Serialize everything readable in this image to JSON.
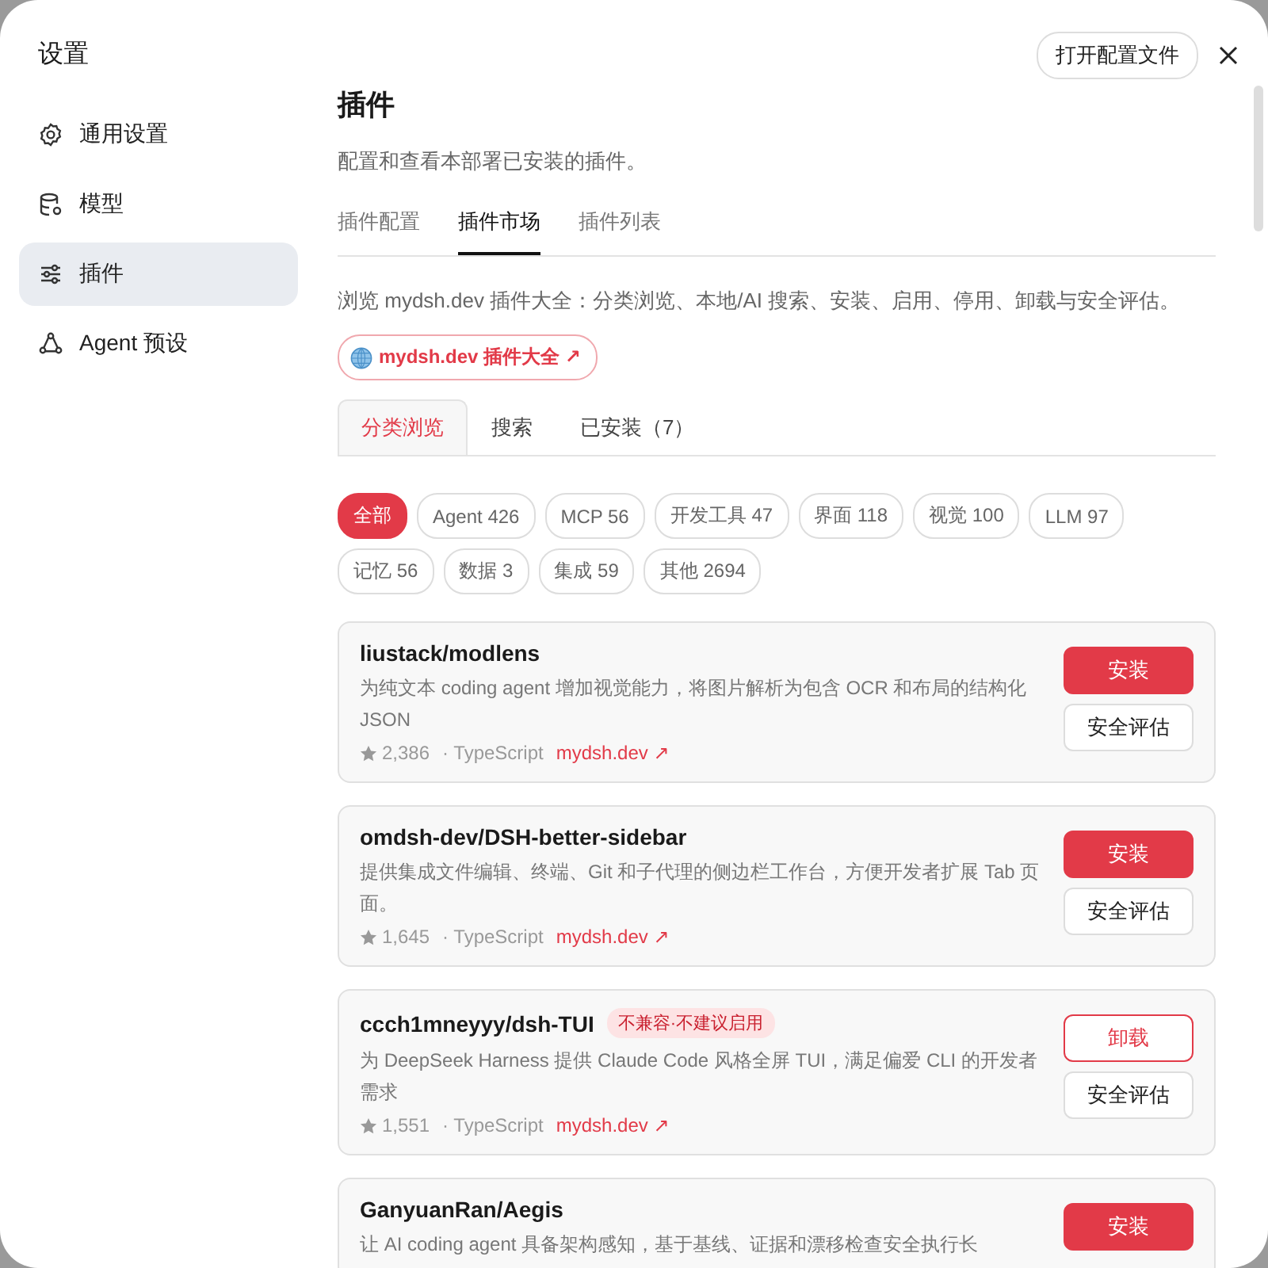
{
  "window": {
    "title": "设置",
    "open_config_button": "打开配置文件"
  },
  "sidebar": {
    "items": [
      {
        "label": "通用设置",
        "selected": false
      },
      {
        "label": "模型",
        "selected": false
      },
      {
        "label": "插件",
        "selected": true
      },
      {
        "label": "Agent 预设",
        "selected": false
      }
    ]
  },
  "page": {
    "title": "插件",
    "subtitle": "配置和查看本部署已安装的插件。"
  },
  "tabs": [
    {
      "label": "插件配置",
      "selected": false
    },
    {
      "label": "插件市场",
      "selected": true
    },
    {
      "label": "插件列表",
      "selected": false
    }
  ],
  "market": {
    "intro": "浏览 mydsh.dev 插件大全：分类浏览、本地/AI 搜索、安装、启用、停用、卸载与安全评估。",
    "catalog_link": "mydsh.dev 插件大全 ↗",
    "subtabs": [
      {
        "label": "分类浏览",
        "selected": true
      },
      {
        "label": "搜索",
        "selected": false
      },
      {
        "label": "已安装（7）",
        "selected": false
      }
    ],
    "categories": [
      {
        "label": "全部",
        "selected": true
      },
      {
        "label": "Agent 426",
        "selected": false
      },
      {
        "label": "MCP 56",
        "selected": false
      },
      {
        "label": "开发工具 47",
        "selected": false
      },
      {
        "label": "界面 118",
        "selected": false
      },
      {
        "label": "视觉 100",
        "selected": false
      },
      {
        "label": "LLM 97",
        "selected": false
      },
      {
        "label": "记忆 56",
        "selected": false
      },
      {
        "label": "数据 3",
        "selected": false
      },
      {
        "label": "集成 59",
        "selected": false
      },
      {
        "label": "其他 2694",
        "selected": false
      }
    ],
    "plugins": [
      {
        "name": "liustack/modlens",
        "description": "为纯文本 coding agent 增加视觉能力，将图片解析为包含 OCR 和布局的结构化 JSON",
        "stars": "2,386",
        "language": "· TypeScript",
        "link": "mydsh.dev ↗",
        "buttons": [
          {
            "label": "安装",
            "kind": "primary"
          },
          {
            "label": "安全评估",
            "kind": "secondary"
          }
        ]
      },
      {
        "name": "omdsh-dev/DSH-better-sidebar",
        "description": "提供集成文件编辑、终端、Git 和子代理的侧边栏工作台，方便开发者扩展 Tab 页面。",
        "stars": "1,645",
        "language": "· TypeScript",
        "link": "mydsh.dev ↗",
        "buttons": [
          {
            "label": "安装",
            "kind": "primary"
          },
          {
            "label": "安全评估",
            "kind": "secondary"
          }
        ]
      },
      {
        "name": "ccch1mneyyy/dsh-TUI",
        "badge": "不兼容·不建议启用",
        "description": "为 DeepSeek Harness 提供 Claude Code 风格全屏 TUI，满足偏爱 CLI 的开发者需求",
        "stars": "1,551",
        "language": "· TypeScript",
        "link": "mydsh.dev ↗",
        "buttons": [
          {
            "label": "卸载",
            "kind": "danger-outline"
          },
          {
            "label": "安全评估",
            "kind": "secondary"
          }
        ]
      },
      {
        "name": "GanyuanRan/Aegis",
        "description": "让 AI coding agent 具备架构感知，基于基线、证据和漂移检查安全执行长",
        "buttons": [
          {
            "label": "安装",
            "kind": "primary"
          }
        ]
      }
    ]
  }
}
